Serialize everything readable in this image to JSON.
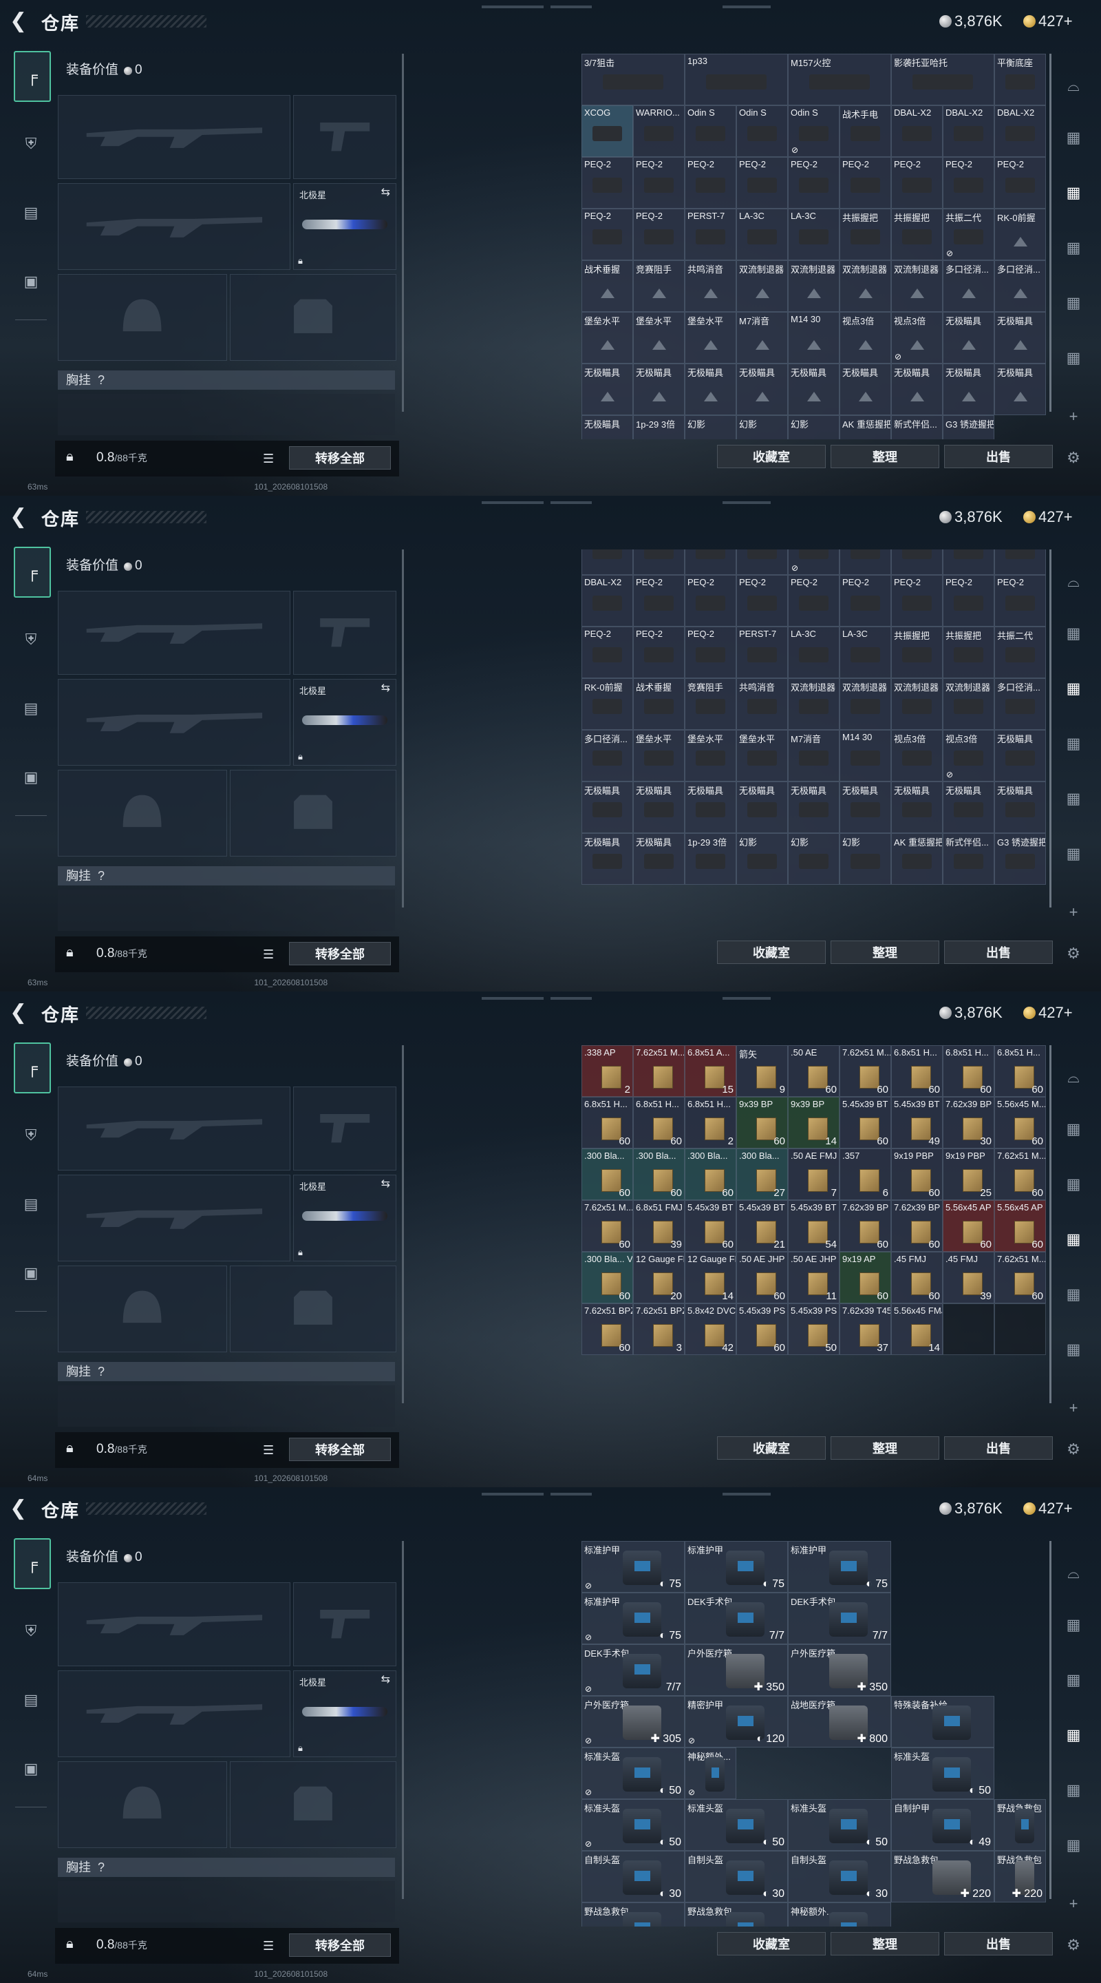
{
  "header": {
    "title": "仓库",
    "currency_silver": "3,876K",
    "currency_gold": "427+"
  },
  "equipment": {
    "value_label": "装备价值",
    "value": "0",
    "scope_label": "北极星",
    "chest_label": "胸挂",
    "chest_q": "?",
    "weight": "0.8",
    "weight_unit": "/88千克",
    "transfer_all": "转移全部"
  },
  "actions": {
    "collect": "收藏室",
    "sort": "整理",
    "sell": "出售"
  },
  "status": {
    "ping1": "63ms",
    "ping2": "63ms",
    "ping3": "64ms",
    "ping4": "64ms",
    "build": "101_202608101508"
  },
  "panel1": {
    "cells": [
      {
        "n": "3/7狙击",
        "t": "scope"
      },
      {
        "n": "1p33",
        "t": "scope"
      },
      {
        "n": "M157火控",
        "t": "scope"
      },
      {
        "n": "影袭托亚哈托",
        "t": "scope"
      },
      {
        "n": "平衡底座",
        "t": "part"
      },
      {
        "n": "XCOG",
        "t": "scope",
        "hl": true
      },
      {
        "n": "WARRIO...",
        "t": "part"
      },
      {
        "n": "Odin S",
        "t": "part"
      },
      {
        "n": "Odin S",
        "t": "part"
      },
      {
        "n": "Odin S",
        "t": "part",
        "lock": true
      },
      {
        "n": "战术手电",
        "t": "part"
      },
      {
        "n": "DBAL-X2",
        "t": "part"
      },
      {
        "n": "DBAL-X2",
        "t": "part"
      },
      {
        "n": "DBAL-X2",
        "t": "part"
      },
      {
        "n": "PEQ-2",
        "t": "part"
      },
      {
        "n": "PEQ-2",
        "t": "part"
      },
      {
        "n": "PEQ-2",
        "t": "part"
      },
      {
        "n": "PEQ-2",
        "t": "part"
      },
      {
        "n": "PEQ-2",
        "t": "part"
      },
      {
        "n": "PEQ-2",
        "t": "part"
      },
      {
        "n": "PEQ-2",
        "t": "part"
      },
      {
        "n": "PEQ-2",
        "t": "part"
      },
      {
        "n": "PEQ-2",
        "t": "part"
      },
      {
        "n": "PEQ-2",
        "t": "part"
      },
      {
        "n": "PEQ-2",
        "t": "part"
      },
      {
        "n": "PERST-7",
        "t": "part"
      },
      {
        "n": "LA-3C",
        "t": "part"
      },
      {
        "n": "LA-3C",
        "t": "part"
      },
      {
        "n": "共振握把",
        "t": "part"
      },
      {
        "n": "共振握把",
        "t": "part"
      },
      {
        "n": "共振二代",
        "t": "part",
        "lock": true
      },
      {
        "n": "RK-0前握",
        "t": "tri"
      },
      {
        "n": "战术垂握",
        "t": "tri"
      },
      {
        "n": "竞赛阻手",
        "t": "tri"
      },
      {
        "n": "共鸣消音",
        "t": "tri"
      },
      {
        "n": "双流制退器",
        "t": "tri"
      },
      {
        "n": "双流制退器",
        "t": "tri"
      },
      {
        "n": "双流制退器",
        "t": "tri"
      },
      {
        "n": "双流制退器",
        "t": "tri"
      },
      {
        "n": "多口径消...",
        "t": "tri"
      },
      {
        "n": "多口径消...",
        "t": "tri"
      },
      {
        "n": "堡垒水平",
        "t": "tri"
      },
      {
        "n": "堡垒水平",
        "t": "tri"
      },
      {
        "n": "堡垒水平",
        "t": "tri"
      },
      {
        "n": "M7消音",
        "t": "tri"
      },
      {
        "n": "M14 30",
        "t": "tri"
      },
      {
        "n": "视点3倍",
        "t": "tri"
      },
      {
        "n": "视点3倍",
        "t": "tri",
        "lock": true
      },
      {
        "n": "无极瞄具",
        "t": "tri"
      },
      {
        "n": "无极瞄具",
        "t": "tri"
      },
      {
        "n": "无极瞄具",
        "t": "tri"
      },
      {
        "n": "无极瞄具",
        "t": "tri"
      },
      {
        "n": "无极瞄具",
        "t": "tri"
      },
      {
        "n": "无极瞄具",
        "t": "tri"
      },
      {
        "n": "无极瞄具",
        "t": "tri"
      },
      {
        "n": "无极瞄具",
        "t": "tri"
      },
      {
        "n": "无极瞄具",
        "t": "tri"
      },
      {
        "n": "无极瞄具",
        "t": "tri"
      },
      {
        "n": "无极瞄具",
        "t": "tri"
      },
      {
        "n": "无极瞄具",
        "t": "tri"
      },
      {
        "n": "1p-29 3倍",
        "t": "tri"
      },
      {
        "n": "幻影",
        "t": "tri"
      },
      {
        "n": "幻影",
        "t": "tri"
      },
      {
        "n": "幻影",
        "t": "tri"
      },
      {
        "n": "AK 重惩握把",
        "t": "tri"
      },
      {
        "n": "新式伴侣...",
        "t": "tri"
      },
      {
        "n": "G3 锈迹握把",
        "t": "tri"
      }
    ]
  },
  "panel2": {
    "cells": [
      {
        "n": "",
        "t": "scope"
      },
      {
        "n": "",
        "t": "part"
      },
      {
        "n": "",
        "t": "part"
      },
      {
        "n": "",
        "t": "part"
      },
      {
        "n": "",
        "t": "part",
        "lock": true
      },
      {
        "n": "",
        "t": "part"
      },
      {
        "n": "",
        "t": "part"
      },
      {
        "n": "",
        "t": "part"
      },
      {
        "n": "",
        "t": "part"
      },
      {
        "n": "DBAL-X2",
        "t": "part"
      },
      {
        "n": "PEQ-2",
        "t": "part"
      },
      {
        "n": "PEQ-2",
        "t": "part"
      },
      {
        "n": "PEQ-2",
        "t": "part"
      },
      {
        "n": "PEQ-2",
        "t": "part"
      },
      {
        "n": "PEQ-2",
        "t": "part"
      },
      {
        "n": "PEQ-2",
        "t": "part"
      },
      {
        "n": "PEQ-2",
        "t": "part"
      },
      {
        "n": "PEQ-2",
        "t": "part"
      },
      {
        "n": "PEQ-2",
        "t": "part"
      },
      {
        "n": "PEQ-2",
        "t": "part"
      },
      {
        "n": "PEQ-2",
        "t": "part"
      },
      {
        "n": "PERST-7",
        "t": "part"
      },
      {
        "n": "LA-3C",
        "t": "part"
      },
      {
        "n": "LA-3C",
        "t": "part"
      },
      {
        "n": "共振握把",
        "t": "part"
      },
      {
        "n": "共振握把",
        "t": "part"
      },
      {
        "n": "共振二代",
        "t": "part"
      },
      {
        "n": "RK-0前握",
        "t": "part"
      },
      {
        "n": "战术垂握",
        "t": "part"
      },
      {
        "n": "竞赛阻手",
        "t": "part"
      },
      {
        "n": "共鸣消音",
        "t": "part"
      },
      {
        "n": "双流制退器",
        "t": "part"
      },
      {
        "n": "双流制退器",
        "t": "part"
      },
      {
        "n": "双流制退器",
        "t": "part"
      },
      {
        "n": "双流制退器",
        "t": "part"
      },
      {
        "n": "多口径消...",
        "t": "part"
      },
      {
        "n": "多口径消...",
        "t": "part"
      },
      {
        "n": "堡垒水平",
        "t": "part"
      },
      {
        "n": "堡垒水平",
        "t": "part"
      },
      {
        "n": "堡垒水平",
        "t": "part"
      },
      {
        "n": "M7消音",
        "t": "part"
      },
      {
        "n": "M14 30",
        "t": "part"
      },
      {
        "n": "视点3倍",
        "t": "part"
      },
      {
        "n": "视点3倍",
        "t": "part",
        "lock": true
      },
      {
        "n": "无极瞄具",
        "t": "part"
      },
      {
        "n": "无极瞄具",
        "t": "part"
      },
      {
        "n": "无极瞄具",
        "t": "part"
      },
      {
        "n": "无极瞄具",
        "t": "part"
      },
      {
        "n": "无极瞄具",
        "t": "part"
      },
      {
        "n": "无极瞄具",
        "t": "part"
      },
      {
        "n": "无极瞄具",
        "t": "part"
      },
      {
        "n": "无极瞄具",
        "t": "part"
      },
      {
        "n": "无极瞄具",
        "t": "part"
      },
      {
        "n": "无极瞄具",
        "t": "part"
      },
      {
        "n": "无极瞄具",
        "t": "part"
      },
      {
        "n": "无极瞄具",
        "t": "part"
      },
      {
        "n": "1p-29 3倍",
        "t": "part"
      },
      {
        "n": "幻影",
        "t": "part"
      },
      {
        "n": "幻影",
        "t": "part"
      },
      {
        "n": "幻影",
        "t": "part"
      },
      {
        "n": "AK 重惩握把",
        "t": "part"
      },
      {
        "n": "新式伴侣...",
        "t": "part"
      },
      {
        "n": "G3 锈迹握把",
        "t": "part"
      }
    ]
  },
  "panel3": {
    "cells": [
      {
        "n": ".338 AP",
        "q": "2",
        "c": "red"
      },
      {
        "n": "7.62x51 M...",
        "q": "",
        "c": "red"
      },
      {
        "n": "6.8x51 A...",
        "q": "15",
        "c": "red"
      },
      {
        "n": "箭矢",
        "q": "9",
        "c": ""
      },
      {
        "n": ".50 AE",
        "q": "60",
        "c": ""
      },
      {
        "n": "7.62x51 M...",
        "q": "60",
        "c": ""
      },
      {
        "n": "6.8x51 H...",
        "q": "60",
        "c": ""
      },
      {
        "n": "6.8x51 H...",
        "q": "60",
        "c": ""
      },
      {
        "n": "6.8x51 H...",
        "q": "60",
        "c": ""
      },
      {
        "n": "6.8x51 H...",
        "q": "60",
        "c": ""
      },
      {
        "n": "6.8x51 H...",
        "q": "60",
        "c": ""
      },
      {
        "n": "6.8x51 H...",
        "q": "2",
        "c": ""
      },
      {
        "n": "9x39 BP",
        "q": "60",
        "c": "green"
      },
      {
        "n": "9x39 BP",
        "q": "14",
        "c": "green"
      },
      {
        "n": "5.45x39 BT",
        "q": "60",
        "c": ""
      },
      {
        "n": "5.45x39 BT",
        "q": "49",
        "c": ""
      },
      {
        "n": "7.62x39 BP",
        "q": "30",
        "c": ""
      },
      {
        "n": "5.56x45 M...",
        "q": "60",
        "c": ""
      },
      {
        "n": ".300 Bla...",
        "q": "60",
        "c": "teal"
      },
      {
        "n": ".300 Bla...",
        "q": "60",
        "c": "teal"
      },
      {
        "n": ".300 Bla...",
        "q": "60",
        "c": "teal"
      },
      {
        "n": ".300 Bla...",
        "q": "27",
        "c": "teal"
      },
      {
        "n": ".50 AE FMJ",
        "q": "7",
        "c": ""
      },
      {
        "n": ".357",
        "q": "6",
        "c": ""
      },
      {
        "n": "9x19 PBP",
        "q": "60",
        "c": ""
      },
      {
        "n": "9x19 PBP",
        "q": "25",
        "c": ""
      },
      {
        "n": "7.62x51 M...",
        "q": "60",
        "c": ""
      },
      {
        "n": "7.62x51 M...",
        "q": "60",
        "c": ""
      },
      {
        "n": "6.8x51 FMJ",
        "q": "39",
        "c": ""
      },
      {
        "n": "5.45x39 BT",
        "q": "60",
        "c": ""
      },
      {
        "n": "5.45x39 BT",
        "q": "21",
        "c": ""
      },
      {
        "n": "5.45x39 BT",
        "q": "54",
        "c": ""
      },
      {
        "n": "7.62x39 BP",
        "q": "60",
        "c": ""
      },
      {
        "n": "7.62x39 BP",
        "q": "60",
        "c": ""
      },
      {
        "n": "5.56x45 AP",
        "q": "60",
        "c": "red"
      },
      {
        "n": "5.56x45 AP",
        "q": "60",
        "c": "red"
      },
      {
        "n": ".300 Bla... V",
        "q": "60",
        "c": "teal"
      },
      {
        "n": "12 Gauge FB",
        "q": "20",
        "c": ""
      },
      {
        "n": "12 Gauge FB",
        "q": "14",
        "c": ""
      },
      {
        "n": ".50 AE JHP",
        "q": "60",
        "c": ""
      },
      {
        "n": ".50 AE JHP",
        "q": "11",
        "c": ""
      },
      {
        "n": "9x19 AP",
        "q": "60",
        "c": "green"
      },
      {
        "n": ".45 FMJ",
        "q": "60",
        "c": ""
      },
      {
        "n": ".45 FMJ",
        "q": "39",
        "c": ""
      },
      {
        "n": "7.62x51 M...",
        "q": "60",
        "c": ""
      },
      {
        "n": "7.62x51 BPZ",
        "q": "60",
        "c": ""
      },
      {
        "n": "7.62x51 BPZ",
        "q": "3",
        "c": ""
      },
      {
        "n": "5.8x42 DVC",
        "q": "42",
        "c": ""
      },
      {
        "n": "5.45x39 PS",
        "q": "60",
        "c": ""
      },
      {
        "n": "5.45x39 PS",
        "q": "50",
        "c": ""
      },
      {
        "n": "7.62x39 T45M",
        "q": "37",
        "c": ""
      },
      {
        "n": "5.56x45 FMJ",
        "q": "14",
        "c": ""
      },
      {
        "n": "",
        "q": "",
        "c": "empty"
      },
      {
        "n": "",
        "q": "",
        "c": "empty"
      }
    ]
  },
  "panel4": {
    "items": [
      {
        "n": "标准护甲",
        "v": "75",
        "k": "shield",
        "lock": true
      },
      {
        "n": "标准护甲",
        "v": "75",
        "k": "shield",
        "lock": false
      },
      {
        "n": "标准护甲",
        "v": "75",
        "k": "shield",
        "lock": false
      },
      {
        "n": "标准护甲",
        "v": "75",
        "k": "shield",
        "lock": true
      },
      {
        "n": "DEK手术包",
        "v": "7/7",
        "k": "none",
        "lock": false
      },
      {
        "n": "DEK手术包",
        "v": "7/7",
        "k": "none",
        "lock": false
      },
      {
        "n": "DEK手术包",
        "v": "7/7",
        "k": "none",
        "lock": true
      },
      {
        "n": "户外医疗箱",
        "v": "350",
        "k": "plus",
        "lock": false
      },
      {
        "n": "户外医疗箱",
        "v": "350",
        "k": "plus",
        "lock": false
      },
      {
        "n": "户外医疗箱",
        "v": "305",
        "k": "plus",
        "lock": true
      },
      {
        "n": "精密护甲",
        "v": "120",
        "k": "shield",
        "lock": true
      },
      {
        "n": "战地医疗箱",
        "v": "800",
        "k": "plus",
        "lock": false
      },
      {
        "n": "特殊装备补给",
        "v": "",
        "k": "none",
        "lock": false
      },
      {
        "n": "标准头盔",
        "v": "50",
        "k": "shield",
        "lock": true
      },
      {
        "n": "神秘额外...",
        "v": "",
        "k": "none",
        "lock": true
      },
      {
        "n": "标准头盔",
        "v": "50",
        "k": "shield",
        "lock": false
      },
      {
        "n": "标准头盔",
        "v": "50",
        "k": "shield",
        "lock": true
      },
      {
        "n": "标准头盔",
        "v": "50",
        "k": "shield",
        "lock": false
      },
      {
        "n": "标准头盔",
        "v": "50",
        "k": "shield",
        "lock": false
      },
      {
        "n": "自制护甲",
        "v": "49",
        "k": "shield",
        "lock": false
      },
      {
        "n": "野战急救包",
        "v": "",
        "k": "none",
        "lock": false
      },
      {
        "n": "自制头盔",
        "v": "30",
        "k": "shield",
        "lock": false
      },
      {
        "n": "自制头盔",
        "v": "30",
        "k": "shield",
        "lock": false
      },
      {
        "n": "自制头盔",
        "v": "30",
        "k": "shield",
        "lock": false
      },
      {
        "n": "野战急救包",
        "v": "220",
        "k": "plus",
        "lock": false
      },
      {
        "n": "野战急救包",
        "v": "220",
        "k": "plus",
        "lock": false
      },
      {
        "n": "野战急救包",
        "v": "",
        "k": "none",
        "lock": false
      },
      {
        "n": "野战急救包",
        "v": "",
        "k": "none",
        "lock": false
      },
      {
        "n": "神秘额外...",
        "v": "",
        "k": "none",
        "lock": false
      }
    ]
  },
  "colors": {
    "accent": "#4fc3a0",
    "cell_bg": "#2d3446"
  }
}
